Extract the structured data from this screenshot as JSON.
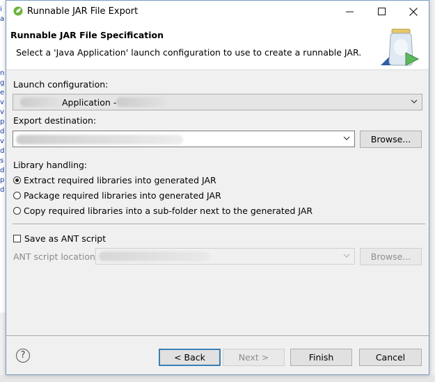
{
  "window": {
    "title": "Runnable JAR File Export",
    "controls": {
      "minimize": "—",
      "maximize": "☐",
      "close": "✕"
    }
  },
  "header": {
    "title": "Runnable JAR File Specification",
    "description": "Select a 'Java Application' launch configuration to use to create a runnable JAR."
  },
  "launch": {
    "label": "Launch configuration:",
    "value": "Application -"
  },
  "export": {
    "label": "Export destination:",
    "browse": "Browse..."
  },
  "library": {
    "label": "Library handling:",
    "options": [
      {
        "label": "Extract required libraries into generated JAR",
        "checked": true
      },
      {
        "label": "Package required libraries into generated JAR",
        "checked": false
      },
      {
        "label": "Copy required libraries into a sub-folder next to the generated JAR",
        "checked": false
      }
    ]
  },
  "ant": {
    "save_label": "Save as ANT script",
    "save_checked": false,
    "location_label": "ANT script location:",
    "browse": "Browse..."
  },
  "footer": {
    "help": "?",
    "back": "< Back",
    "next": "Next >",
    "finish": "Finish",
    "cancel": "Cancel"
  },
  "colors": {
    "default_button_border": "#3c7fb1",
    "dialog_border": "#7a9cc6",
    "disabled_text": "#8a8a8a"
  }
}
